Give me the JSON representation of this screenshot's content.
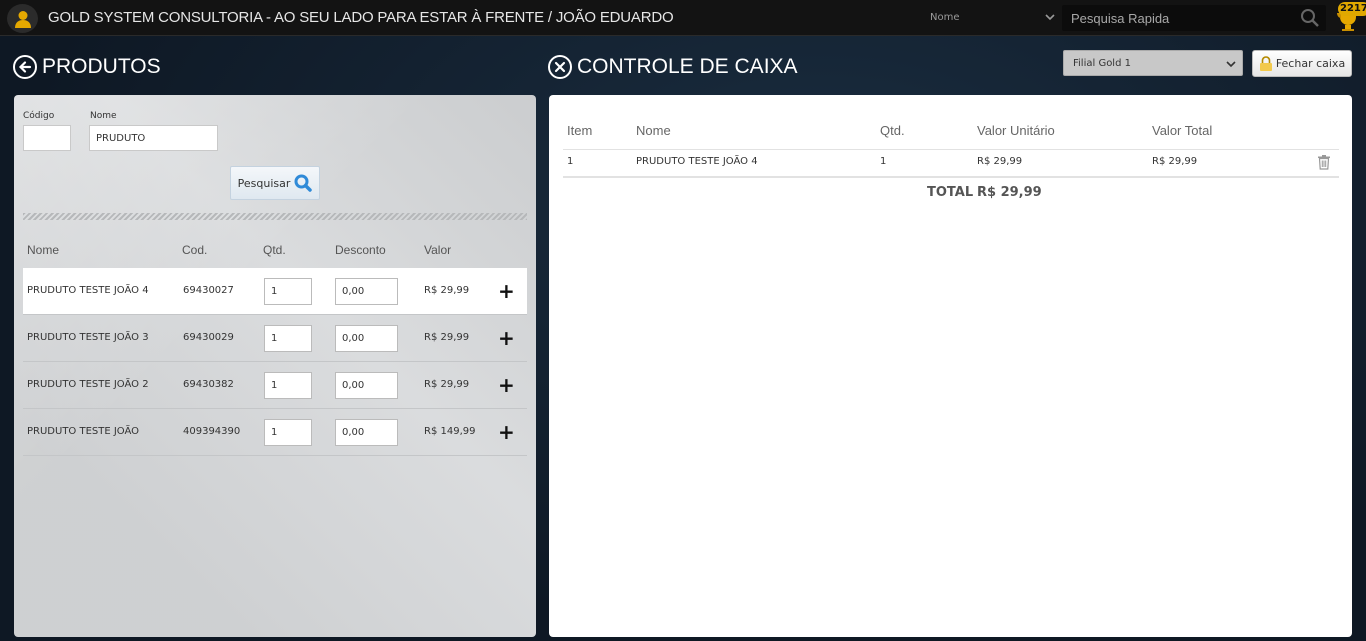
{
  "header": {
    "title": "GOLD SYSTEM CONSULTORIA - AO SEU LADO PARA ESTAR À FRENTE / JOÃO EDUARDO",
    "search_type": "Nome",
    "search_placeholder": "Pesquisa Rapida",
    "notifications_count": "2217"
  },
  "produtos": {
    "heading": "PRODUTOS",
    "codigo_label": "Código",
    "codigo_value": "",
    "nome_label": "Nome",
    "nome_value": "PRUDUTO",
    "search_button": "Pesquisar",
    "columns": [
      "Nome",
      "Cod.",
      "Qtd.",
      "Desconto",
      "Valor"
    ],
    "rows": [
      {
        "nome": "PRUDUTO TESTE JOÃO 4",
        "cod": "69430027",
        "qtd": "1",
        "desconto": "0,00",
        "valor": "R$ 29,99"
      },
      {
        "nome": "PRUDUTO TESTE JOÃO 3",
        "cod": "69430029",
        "qtd": "1",
        "desconto": "0,00",
        "valor": "R$ 29,99"
      },
      {
        "nome": "PRUDUTO TESTE JOÃO 2",
        "cod": "69430382",
        "qtd": "1",
        "desconto": "0,00",
        "valor": "R$ 29,99"
      },
      {
        "nome": "PRUDUTO TESTE JOÃO",
        "cod": "409394390",
        "qtd": "1",
        "desconto": "0,00",
        "valor": "R$ 149,99"
      }
    ]
  },
  "caixa": {
    "heading": "CONTROLE DE CAIXA",
    "filial": "Filial Gold 1",
    "fechar_button": "Fechar caixa",
    "columns": [
      "Item",
      "Nome",
      "Qtd.",
      "Valor Unitário",
      "Valor Total"
    ],
    "rows": [
      {
        "item": "1",
        "nome": "PRUDUTO TESTE JOÃO 4",
        "qtd": "1",
        "valor_unitario": "R$ 29,99",
        "valor_total": "R$ 29,99"
      }
    ],
    "total_label": "TOTAL",
    "total_value": "R$ 29,99"
  },
  "colors": {
    "accent": "#e0a800",
    "search_button_icon": "#2f8ad8"
  }
}
